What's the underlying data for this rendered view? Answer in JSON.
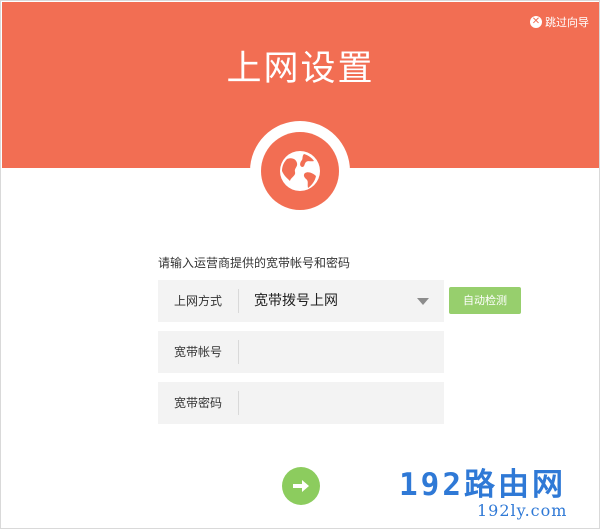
{
  "header": {
    "title": "上网设置",
    "skip_label": "跳过向导",
    "skip_icon": "close-icon",
    "background_color": "#f26e53"
  },
  "main": {
    "prompt": "请输入运营商提供的宽带帐号和密码",
    "connection_type": {
      "label": "上网方式",
      "value": "宽带拨号上网",
      "detect_button": "自动检测"
    },
    "account": {
      "label": "宽带帐号",
      "value": "",
      "placeholder": ""
    },
    "password": {
      "label": "宽带密码",
      "value": "",
      "placeholder": ""
    },
    "next_icon": "arrow-right-icon"
  },
  "watermark": {
    "main": "192路由网",
    "sub": "192ly.com"
  },
  "colors": {
    "accent": "#f26e53",
    "button_green": "#97cf6d",
    "watermark_blue": "#2f79d6"
  }
}
